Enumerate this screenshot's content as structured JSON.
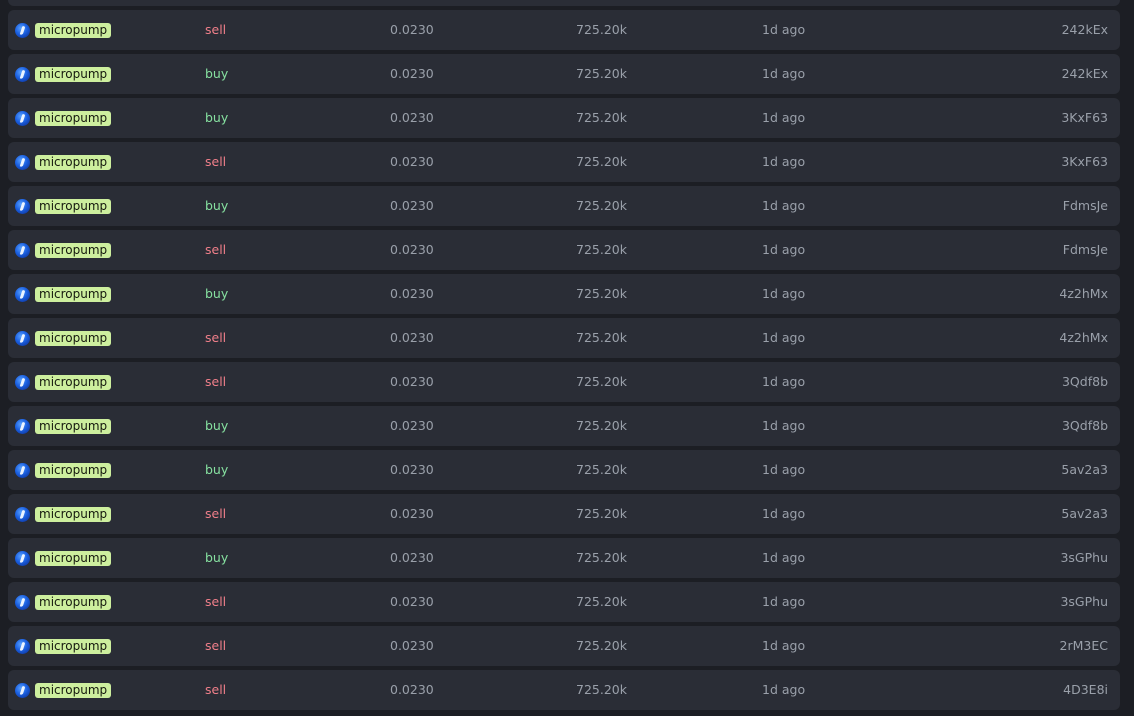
{
  "colors": {
    "buy": "#86e0a0",
    "sell": "#f07f8a",
    "token_badge_bg": "#cdef9e",
    "row_bg": "#2a2d36",
    "page_bg": "#1c1e24"
  },
  "trades": [
    {
      "icon": "droplet-coin-icon",
      "token": "micropump",
      "type": "sell",
      "price": "0.0230",
      "amount": "725.20k",
      "time": "1d ago",
      "maker": "242kEx"
    },
    {
      "icon": "droplet-coin-icon",
      "token": "micropump",
      "type": "buy",
      "price": "0.0230",
      "amount": "725.20k",
      "time": "1d ago",
      "maker": "242kEx"
    },
    {
      "icon": "droplet-coin-icon",
      "token": "micropump",
      "type": "buy",
      "price": "0.0230",
      "amount": "725.20k",
      "time": "1d ago",
      "maker": "3KxF63"
    },
    {
      "icon": "droplet-coin-icon",
      "token": "micropump",
      "type": "sell",
      "price": "0.0230",
      "amount": "725.20k",
      "time": "1d ago",
      "maker": "3KxF63"
    },
    {
      "icon": "droplet-coin-icon",
      "token": "micropump",
      "type": "buy",
      "price": "0.0230",
      "amount": "725.20k",
      "time": "1d ago",
      "maker": "FdmsJe"
    },
    {
      "icon": "droplet-coin-icon",
      "token": "micropump",
      "type": "sell",
      "price": "0.0230",
      "amount": "725.20k",
      "time": "1d ago",
      "maker": "FdmsJe"
    },
    {
      "icon": "droplet-coin-icon",
      "token": "micropump",
      "type": "buy",
      "price": "0.0230",
      "amount": "725.20k",
      "time": "1d ago",
      "maker": "4z2hMx"
    },
    {
      "icon": "droplet-coin-icon",
      "token": "micropump",
      "type": "sell",
      "price": "0.0230",
      "amount": "725.20k",
      "time": "1d ago",
      "maker": "4z2hMx"
    },
    {
      "icon": "droplet-coin-icon",
      "token": "micropump",
      "type": "sell",
      "price": "0.0230",
      "amount": "725.20k",
      "time": "1d ago",
      "maker": "3Qdf8b"
    },
    {
      "icon": "droplet-coin-icon",
      "token": "micropump",
      "type": "buy",
      "price": "0.0230",
      "amount": "725.20k",
      "time": "1d ago",
      "maker": "3Qdf8b"
    },
    {
      "icon": "droplet-coin-icon",
      "token": "micropump",
      "type": "buy",
      "price": "0.0230",
      "amount": "725.20k",
      "time": "1d ago",
      "maker": "5av2a3"
    },
    {
      "icon": "droplet-coin-icon",
      "token": "micropump",
      "type": "sell",
      "price": "0.0230",
      "amount": "725.20k",
      "time": "1d ago",
      "maker": "5av2a3"
    },
    {
      "icon": "droplet-coin-icon",
      "token": "micropump",
      "type": "buy",
      "price": "0.0230",
      "amount": "725.20k",
      "time": "1d ago",
      "maker": "3sGPhu"
    },
    {
      "icon": "droplet-coin-icon",
      "token": "micropump",
      "type": "sell",
      "price": "0.0230",
      "amount": "725.20k",
      "time": "1d ago",
      "maker": "3sGPhu"
    },
    {
      "icon": "droplet-coin-icon",
      "token": "micropump",
      "type": "sell",
      "price": "0.0230",
      "amount": "725.20k",
      "time": "1d ago",
      "maker": "2rM3EC"
    },
    {
      "icon": "droplet-coin-icon",
      "token": "micropump",
      "type": "sell",
      "price": "0.0230",
      "amount": "725.20k",
      "time": "1d ago",
      "maker": "4D3E8i"
    }
  ]
}
